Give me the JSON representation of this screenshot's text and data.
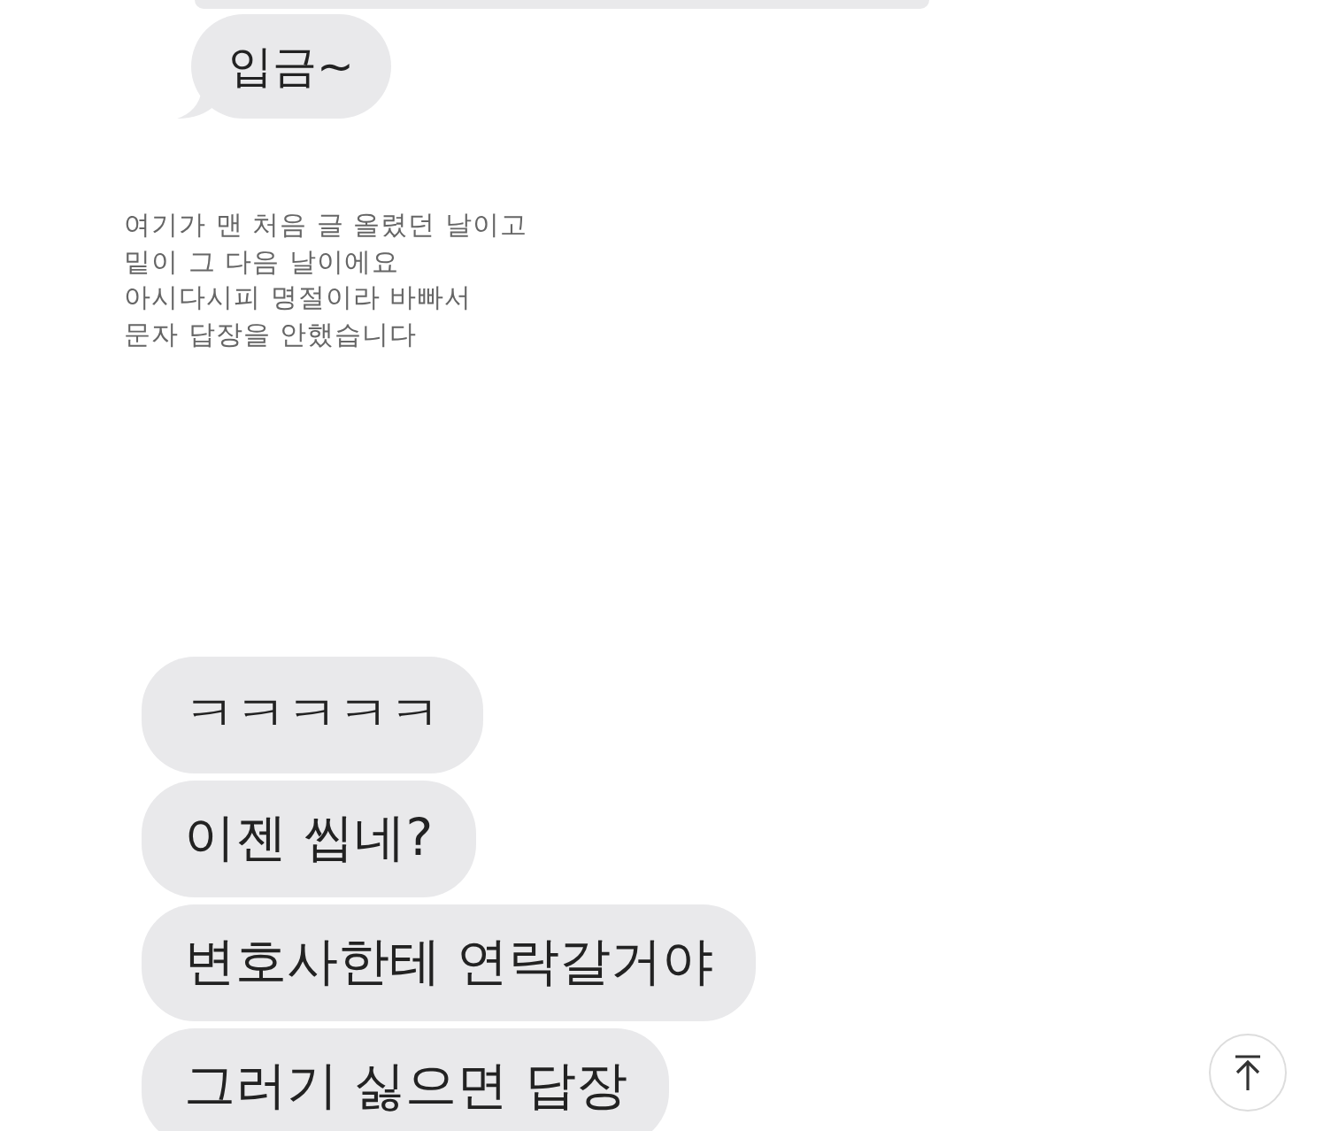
{
  "screenshot_1": {
    "messages": [
      {
        "text": "입금~",
        "tail": true
      }
    ]
  },
  "post_text": [
    "여기가 맨 처음 글 올렸던 날이고",
    "밑이 그 다음 날이에요",
    "아시다시피 명절이라 바빠서",
    "문자 답장을 안했습니다"
  ],
  "screenshot_2": {
    "messages": [
      {
        "text": "ㅋㅋㅋㅋㅋ",
        "tail": false
      },
      {
        "text": "이젠 씹네?",
        "tail": false
      },
      {
        "text": "변호사한테 연락갈거야",
        "tail": false
      },
      {
        "text": "그러기 싫으면 답장",
        "tail": false
      }
    ]
  }
}
